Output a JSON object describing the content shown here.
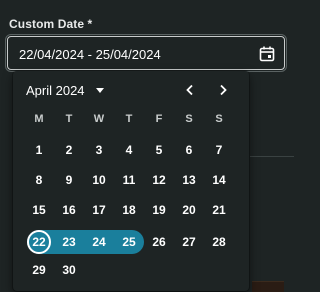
{
  "field": {
    "label": "Custom Date *",
    "value": "22/04/2024 - 25/04/2024"
  },
  "icons": {
    "calendar": "calendar-icon",
    "caret": "caret-down-icon",
    "prev": "chevron-left-icon",
    "next": "chevron-right-icon"
  },
  "calendar": {
    "month_label": "April 2024",
    "weekdays": [
      "M",
      "T",
      "W",
      "T",
      "F",
      "S",
      "S"
    ],
    "weeks": [
      [
        "1",
        "2",
        "3",
        "4",
        "5",
        "6",
        "7"
      ],
      [
        "8",
        "9",
        "10",
        "11",
        "12",
        "13",
        "14"
      ],
      [
        "15",
        "16",
        "17",
        "18",
        "19",
        "20",
        "21"
      ],
      [
        "22",
        "23",
        "24",
        "25",
        "26",
        "27",
        "28"
      ],
      [
        "29",
        "30"
      ]
    ],
    "range_start": "22",
    "range_end": "25"
  },
  "colors": {
    "background": "#1e2424",
    "accent": "#1a7f9c",
    "text": "#ffffff",
    "border": "#c9cccc"
  }
}
